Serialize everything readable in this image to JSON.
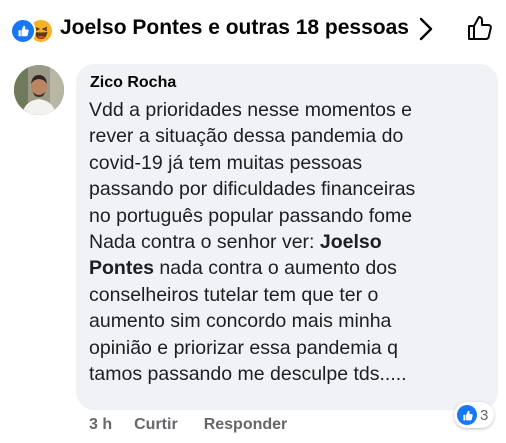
{
  "header": {
    "title": "Joelso Pontes e outras 18 pessoas",
    "reactions": [
      "like-icon",
      "haha-icon"
    ]
  },
  "comment": {
    "author": "Zico Rocha",
    "text_before_mention": "Vdd   a prioridades nesse momentos e\nrever a situação dessa pandemia do\ncovid-19  já tem muitas pessoas\npassando por dificuldades financeiras\nno português popular    passando fome\nNada contra o senhor ver: ",
    "mention": "Joelso\nPontes",
    "text_after_mention": " nada contra  o aumento dos\nconselheiros tutelar tem que ter o\naumento sim concordo  mais minha\nopinião e priorizar   essa pandemia q\ntamos passando me desculpe  tds.....",
    "time": "3 h",
    "like_label": "Curtir",
    "reply_label": "Responder",
    "reaction_count": "3"
  },
  "colors": {
    "accent": "#1877f2",
    "bubble": "#f0f2f5",
    "muted": "#65676b"
  }
}
